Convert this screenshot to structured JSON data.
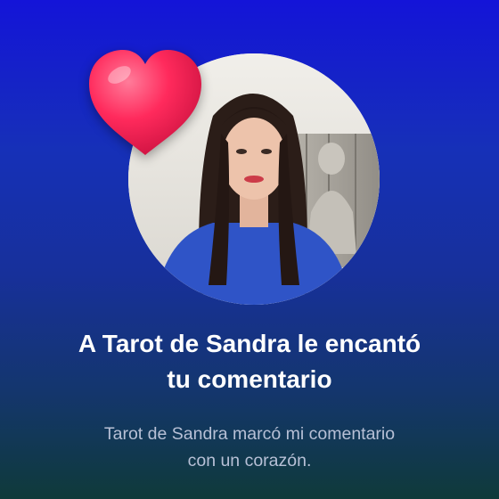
{
  "notification": {
    "title_line1": "A Tarot de Sandra le encantó",
    "title_line2": "tu comentario",
    "subtitle_line1": "Tarot de Sandra marcó mi comentario",
    "subtitle_line2": "con un corazón."
  },
  "icons": {
    "reaction": "heart-icon"
  },
  "colors": {
    "background_top": "#1414d8",
    "background_bottom": "#0f3a3a",
    "heart": "#ff2a5c",
    "title_text": "#ffffff",
    "subtitle_text": "#b7c0d6"
  }
}
